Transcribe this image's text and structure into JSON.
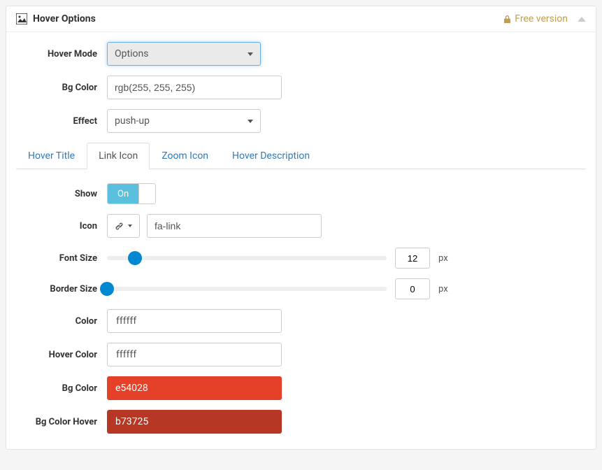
{
  "header": {
    "title": "Hover Options",
    "free_label": "Free version"
  },
  "form": {
    "hover_mode_label": "Hover Mode",
    "hover_mode_value": "Options",
    "bg_color_label": "Bg Color",
    "bg_color_value": "rgb(255, 255, 255)",
    "effect_label": "Effect",
    "effect_value": "push-up"
  },
  "tabs": {
    "t0": "Hover Title",
    "t1": "Link Icon",
    "t2": "Zoom Icon",
    "t3": "Hover Description"
  },
  "link_icon": {
    "show_label": "Show",
    "show_value": "On",
    "icon_label": "Icon",
    "icon_value": "fa-link",
    "font_size_label": "Font Size",
    "font_size_value": "12",
    "font_size_unit": "px",
    "border_size_label": "Border Size",
    "border_size_value": "0",
    "border_size_unit": "px",
    "color_label": "Color",
    "color_value": "ffffff",
    "hover_color_label": "Hover Color",
    "hover_color_value": "ffffff",
    "bg_label": "Bg Color",
    "bg_value": "e54028",
    "bg_hover_label": "Bg Color Hover",
    "bg_hover_value": "b73725"
  },
  "colors": {
    "color": "#ffffff",
    "hover_color": "#ffffff",
    "bg": "#e54028",
    "bg_hover": "#b73725"
  },
  "slider_positions": {
    "font_size_pct": "10",
    "border_size_pct": "0"
  }
}
